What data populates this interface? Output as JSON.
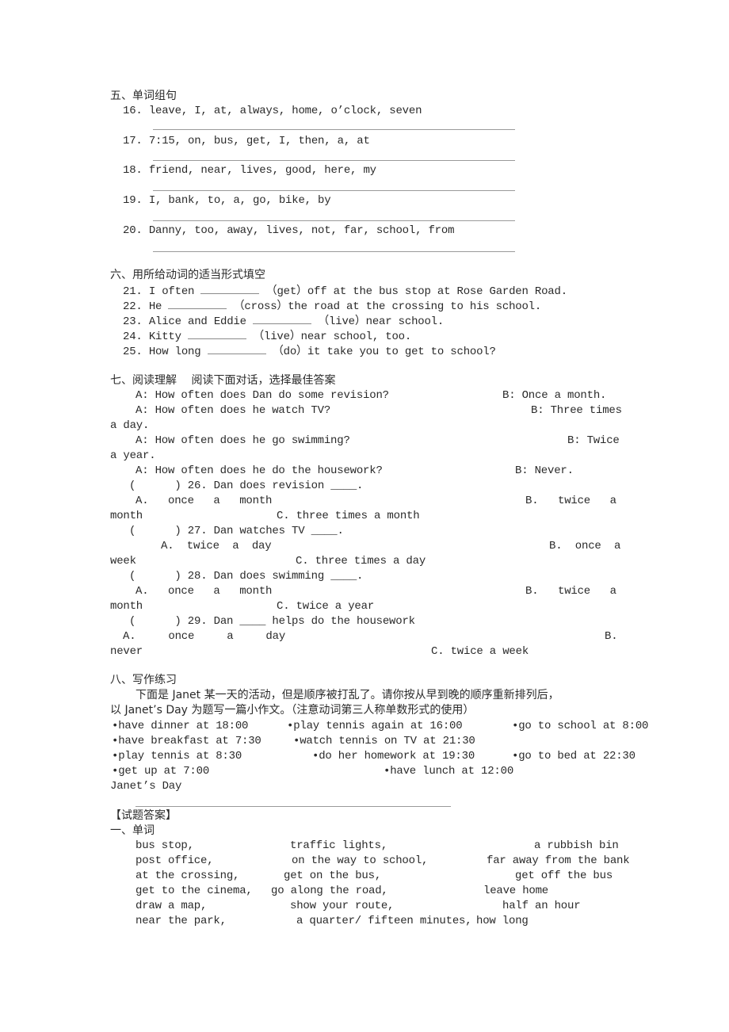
{
  "section5": {
    "title": "五、单词组句",
    "items": [
      {
        "num": "16.",
        "text": "leave, I, at, always, home, o’clock, seven"
      },
      {
        "num": "17.",
        "text": "7:15, on, bus, get, I, then, a, at"
      },
      {
        "num": "18.",
        "text": "friend, near, lives, good, here, my"
      },
      {
        "num": "19.",
        "text": "I, bank, to, a, go, bike, by"
      },
      {
        "num": "20.",
        "text": "Danny, too, away, lives, not, far, school, from"
      }
    ]
  },
  "section6": {
    "title": "六、用所给动词的适当形式填空",
    "items": [
      {
        "num": "21.",
        "before": "I often",
        "verb": "（get）",
        "after": "off at the bus stop at Rose Garden Road."
      },
      {
        "num": "22.",
        "before": "He",
        "verb": "（cross）",
        "after": "the road at the crossing to his school."
      },
      {
        "num": "23.",
        "before": "Alice and Eddie",
        "verb": "（live）",
        "after": "near school."
      },
      {
        "num": "24.",
        "before": "Kitty",
        "verb": "（live）",
        "after": "near school, too."
      },
      {
        "num": "25.",
        "before": "How long",
        "verb": "（do）",
        "after": "it take you to get to school?"
      }
    ]
  },
  "section7": {
    "title": "七、阅读理解　 阅读下面对话，选择最佳答案",
    "dialogue": [
      {
        "a": "A: How often does Dan do some revision?",
        "b": "B: Once a month.",
        "wrap": ""
      },
      {
        "a": "A: How often does he watch TV?",
        "b": "B: Three times",
        "wrap": "a day."
      },
      {
        "a": "A: How often does he go swimming?",
        "b": "B: Twice",
        "wrap": "a year."
      },
      {
        "a": "A: How often does he do the housework?",
        "b": "B: Never.",
        "wrap": ""
      }
    ],
    "questions": [
      {
        "stem": "(      ) 26. Dan does revision ____.",
        "a": "A.   once   a   month",
        "b": "B.   twice   a",
        "wrap": "month",
        "c": "C. three times a month"
      },
      {
        "stem": "(      ) 27. Dan watches TV ____.",
        "a": "A.  twice  a  day",
        "b": "B.  once  a",
        "wrap": "week",
        "c": "C. three times a day"
      },
      {
        "stem": "(      ) 28. Dan does swimming ____.",
        "a": "A.   once   a   month",
        "b": "B.   twice   a",
        "wrap": "month",
        "c": "C. twice a year"
      },
      {
        "stem": "(      ) 29. Dan ____ helps do the housework",
        "a": "A.     once     a     day",
        "b": "B.",
        "wrap": "never",
        "c": "C. twice a week"
      }
    ]
  },
  "section8": {
    "title": "八、写作练习",
    "instruction_1": "下面是 Janet 某一天的活动，但是顺序被打乱了。请你按从早到晚的顺序重新排列后，",
    "instruction_2": "以 Janet’s Day 为题写一篇小作文。（注意动词第三人称单数形式的使用）",
    "activities": [
      "•have dinner at 18:00",
      "•play tennis again at 16:00",
      "•go to school at 8:00",
      "•have breakfast at 7:30",
      "•watch tennis on TV at 21:30",
      "•play tennis at 8:30",
      "•do her homework at 19:30",
      "•go to bed at 22:30",
      "•get up at 7:00",
      "•have lunch at 12:00"
    ],
    "essay_title": "Janet’s Day"
  },
  "answers": {
    "title": "【试题答案】",
    "section1_title": "一、单词",
    "rows": [
      [
        "bus stop,",
        "traffic lights,",
        "a rubbish bin"
      ],
      [
        "post office,",
        "on the way to school,",
        "far away from the bank"
      ],
      [
        "at the crossing,",
        "get on the bus,",
        "get off the bus"
      ],
      [
        "get to the cinema,",
        "go along the road,",
        "leave home"
      ],
      [
        "draw a map,",
        "show your route,",
        "half an hour"
      ],
      [
        "near the park,",
        "a quarter/ fifteen minutes,",
        "how long"
      ]
    ]
  }
}
